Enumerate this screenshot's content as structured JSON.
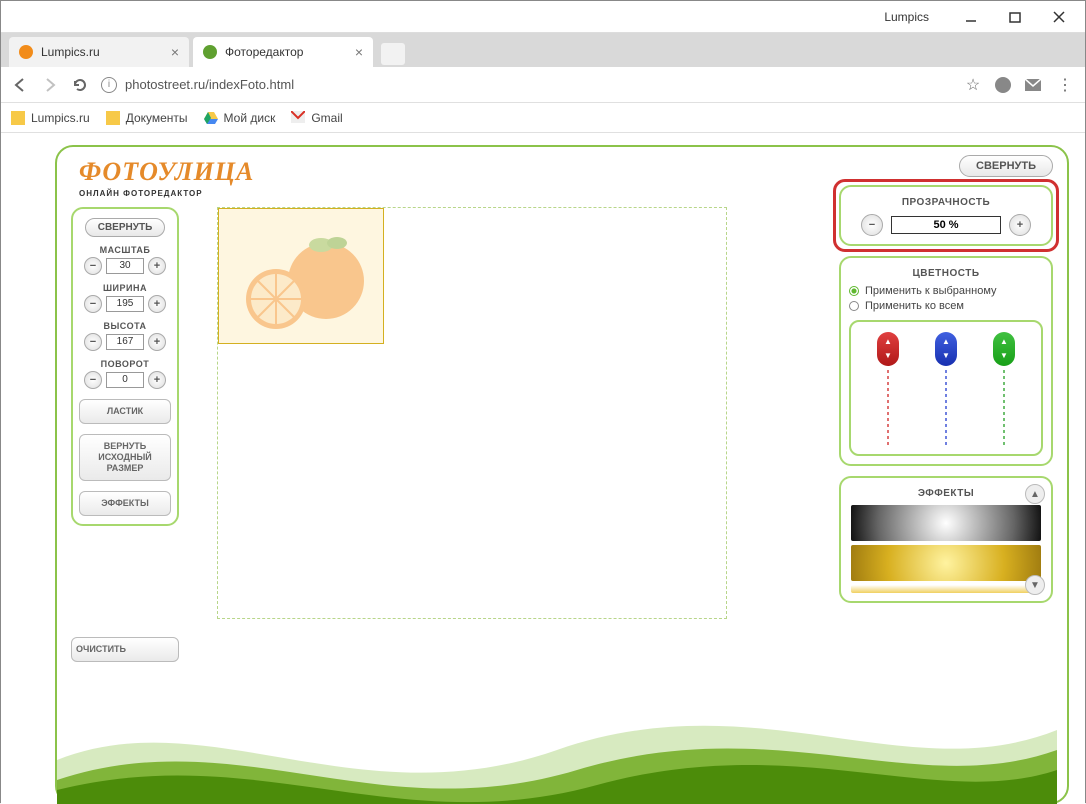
{
  "window": {
    "app_label": "Lumpics"
  },
  "browser": {
    "tabs": [
      {
        "title": "Lumpics.ru",
        "favicon_color": "#f28c1a"
      },
      {
        "title": "Фоторедактор",
        "favicon_color": "#5fa030"
      }
    ],
    "url": "photostreet.ru/indexFoto.html",
    "bookmarks": [
      {
        "label": "Lumpics.ru",
        "color": "#f7c948"
      },
      {
        "label": "Документы",
        "color": "#f7c948"
      },
      {
        "label": "Мой диск",
        "color": ""
      },
      {
        "label": "Gmail",
        "color": ""
      }
    ]
  },
  "app": {
    "logo_main": "ФОТОУЛИЦА",
    "logo_sub": "ОНЛАЙН ФОТОРЕДАКТОР",
    "collapse_label": "СВЕРНУТЬ"
  },
  "left": {
    "scale": {
      "label": "МАСШТАБ",
      "value": "30"
    },
    "width": {
      "label": "ШИРИНА",
      "value": "195"
    },
    "height": {
      "label": "ВЫСОТА",
      "value": "167"
    },
    "rotate": {
      "label": "ПОВОРОТ",
      "value": "0"
    },
    "eraser_label": "ЛАСТИК",
    "restore_label": "ВЕРНУТЬ ИСХОДНЫЙ РАЗМЕР",
    "effects_label": "ЭФФЕКТЫ",
    "clear_label": "ОЧИСТИТЬ"
  },
  "right": {
    "transparency": {
      "title": "ПРОЗРАЧНОСТЬ",
      "value": "50 %"
    },
    "color": {
      "title": "ЦВЕТНОСТЬ",
      "opt_selected": "Применить к выбранному",
      "opt_all": "Применить ко всем"
    },
    "effects": {
      "title": "ЭФФЕКТЫ"
    }
  }
}
